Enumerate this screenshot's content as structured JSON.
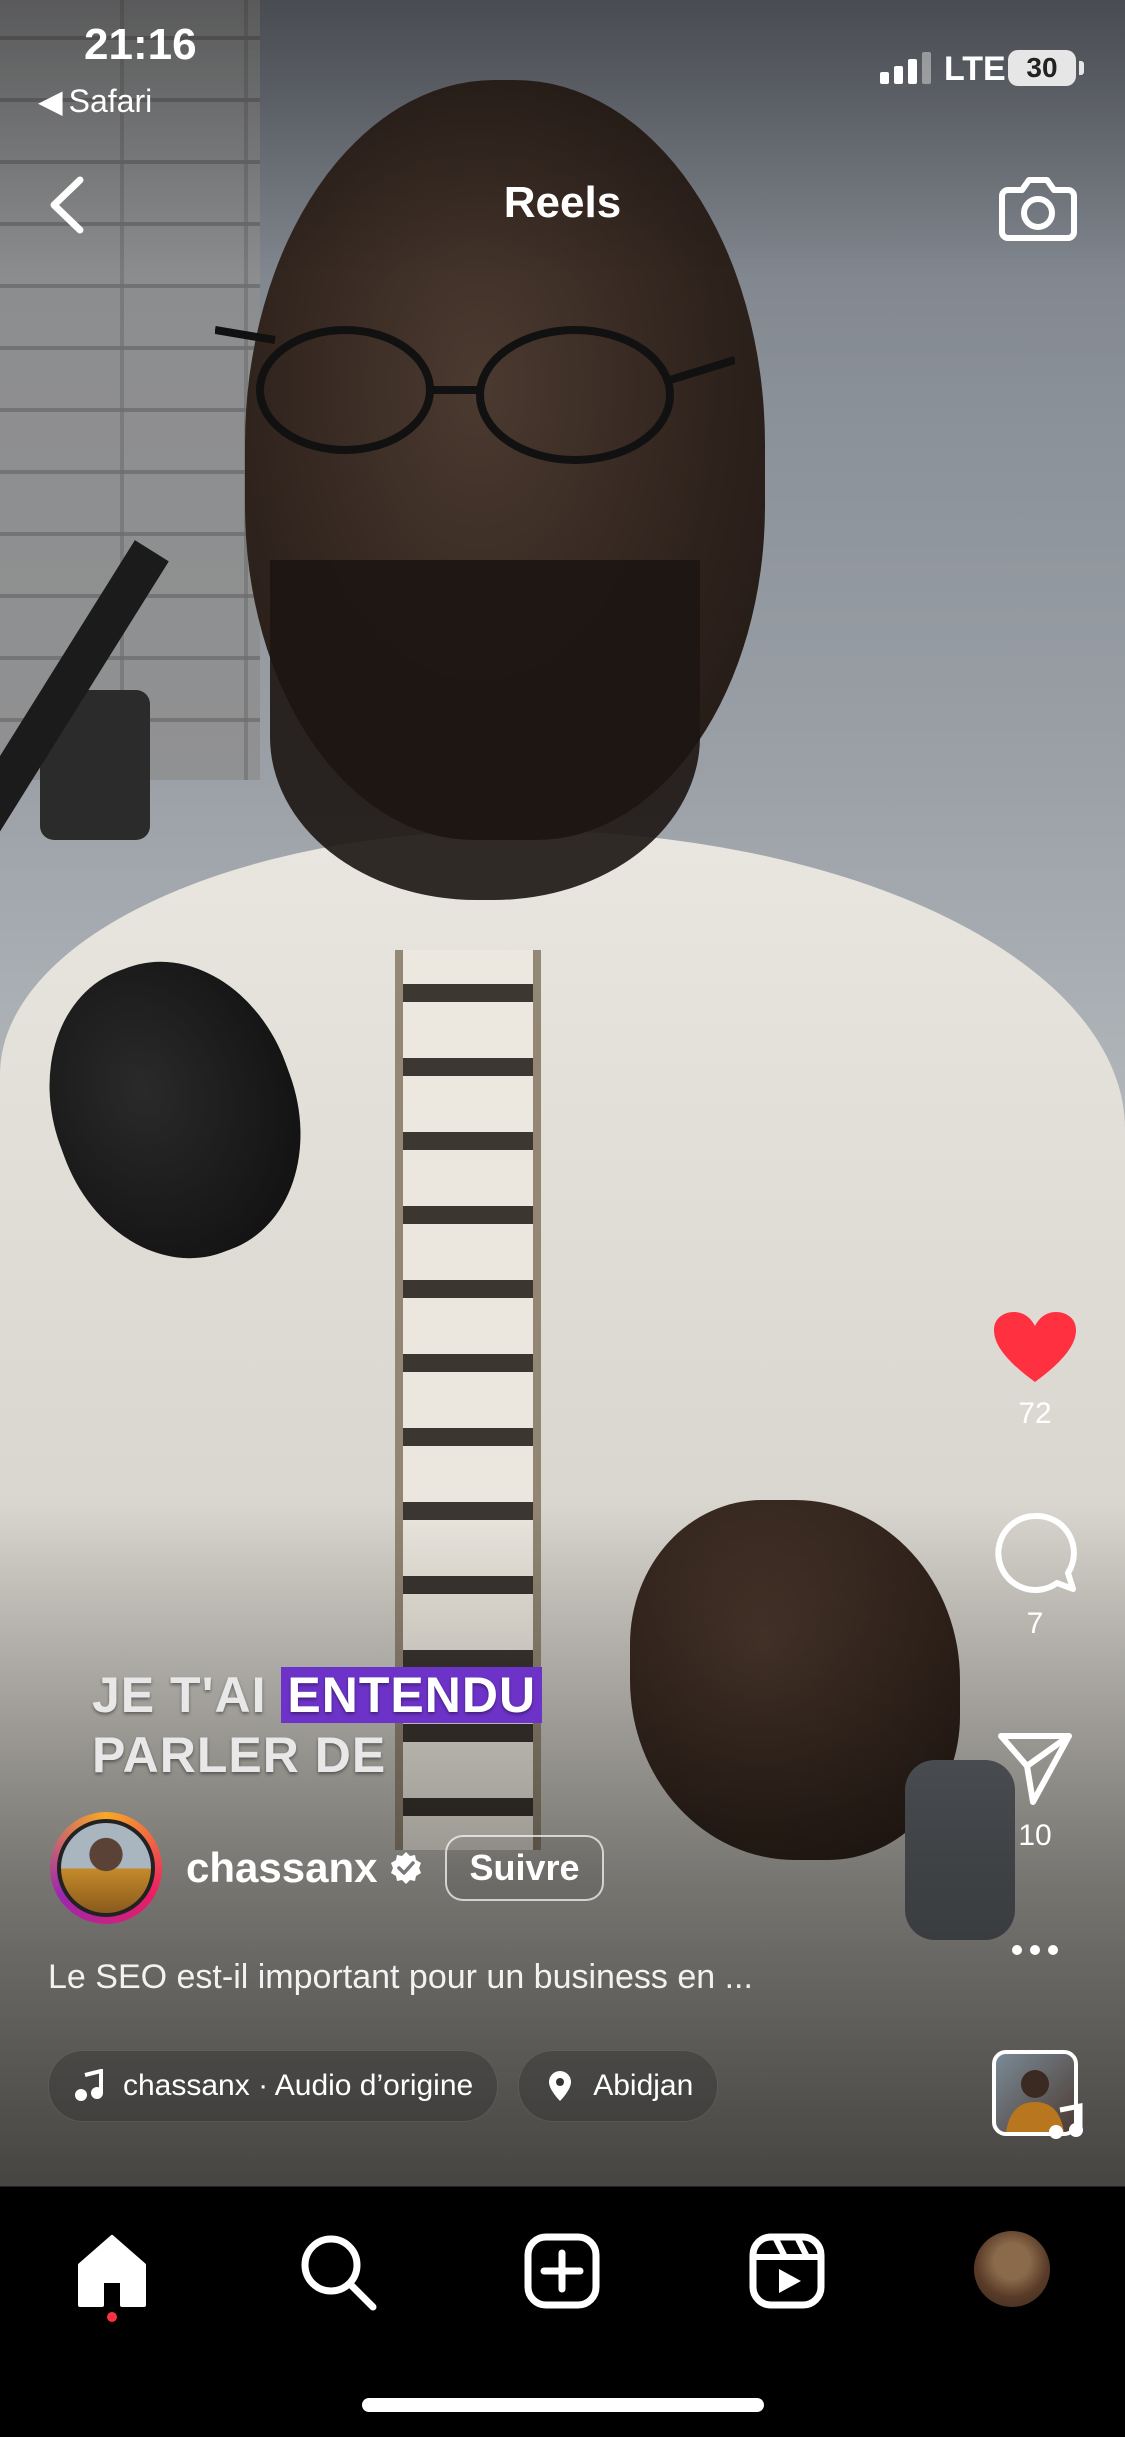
{
  "status_bar": {
    "time": "21:16",
    "back_app": "Safari",
    "network": "LTE",
    "battery": "30"
  },
  "header": {
    "title": "Reels",
    "back_icon": "chevron-left-icon",
    "camera_icon": "camera-icon"
  },
  "video_overlay": {
    "line1_plain": "JE T'AI ",
    "line1_highlight": "ENTENDU",
    "line2": "PARLER DE"
  },
  "actions": {
    "like_count": "72",
    "comment_count": "7",
    "share_count": "10",
    "like_color": "#ff3040"
  },
  "author": {
    "username": "chassanx",
    "verified": true,
    "follow_label": "Suivre"
  },
  "caption": "Le SEO est-il important pour un business en ...",
  "chips": {
    "audio": "chassanx · Audio d’origine",
    "location": "Abidjan"
  },
  "tab_bar": {
    "items": [
      "home-icon",
      "search-icon",
      "create-icon",
      "reels-icon",
      "profile-avatar"
    ],
    "active": "home"
  }
}
